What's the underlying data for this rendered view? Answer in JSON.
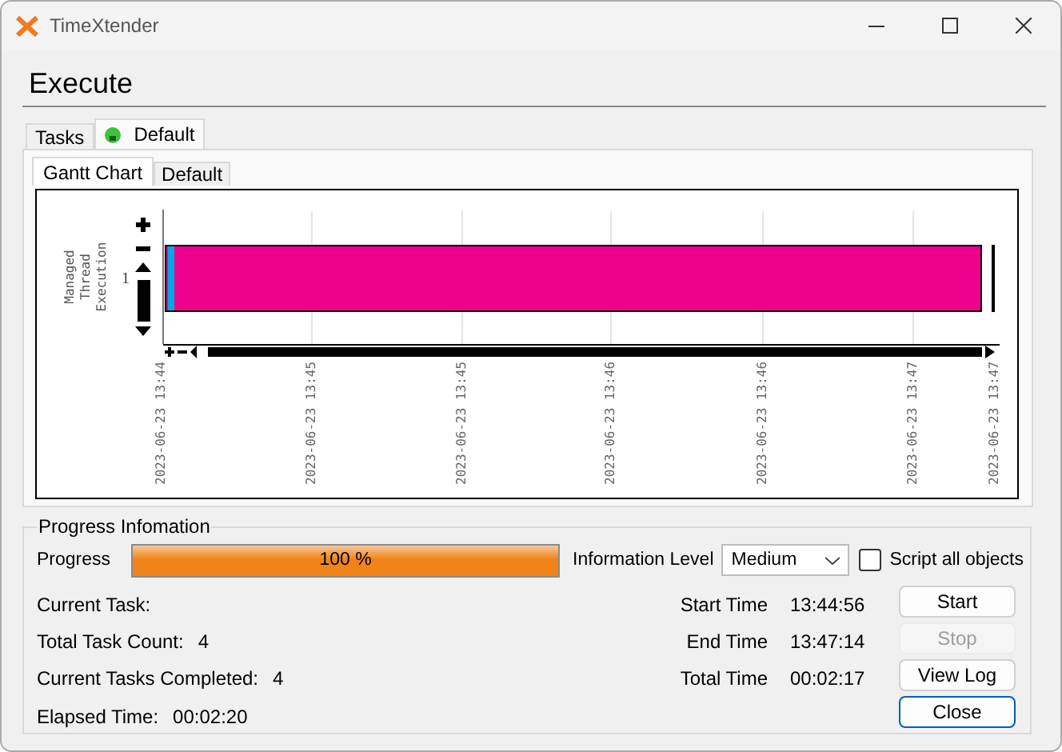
{
  "window": {
    "title": "TimeXtender"
  },
  "heading": "Execute",
  "tabs": [
    {
      "label": "Tasks",
      "selected": false,
      "kind": "plain"
    },
    {
      "label": "Default",
      "selected": true,
      "kind": "status"
    }
  ],
  "subtabs": [
    {
      "label": "Gantt Chart",
      "selected": true
    },
    {
      "label": "Default",
      "selected": false
    }
  ],
  "gantt": {
    "axis_title": "Managed Thread Execution",
    "rows": [
      "1"
    ],
    "time_labels": [
      "2023-06-23 13:44",
      "2023-06-23 13:45",
      "2023-06-23 13:45",
      "2023-06-23 13:46",
      "2023-06-23 13:46",
      "2023-06-23 13:47",
      "2023-06-23 13:47"
    ]
  },
  "progress": {
    "title": "Progress Infomation",
    "label": "Progress",
    "level": 1,
    "reading": "100 %",
    "info_level_label": "Information Level",
    "info_level": "Medium",
    "script_all": {
      "label": "Script all objects",
      "checked": false
    }
  },
  "stats": [
    {
      "label": "Current Task:"
    },
    {
      "label": "Total Task Count:",
      "value": "4"
    },
    {
      "label": "Current Tasks Completed:",
      "value": "4"
    },
    {
      "label": "Elapsed Time:",
      "value": "00:02:20"
    }
  ],
  "times": [
    {
      "label": "Start Time",
      "value": "13:44:56"
    },
    {
      "label": "End Time",
      "value": "13:47:14"
    },
    {
      "label": "Total Time",
      "value": "00:02:17"
    }
  ],
  "buttons": [
    {
      "label": "Start",
      "disabled": false,
      "focused": false
    },
    {
      "label": "Stop",
      "disabled": true,
      "focused": false
    },
    {
      "label": "View Log",
      "disabled": false,
      "focused": false
    },
    {
      "label": "Close",
      "disabled": false,
      "focused": true
    }
  ]
}
